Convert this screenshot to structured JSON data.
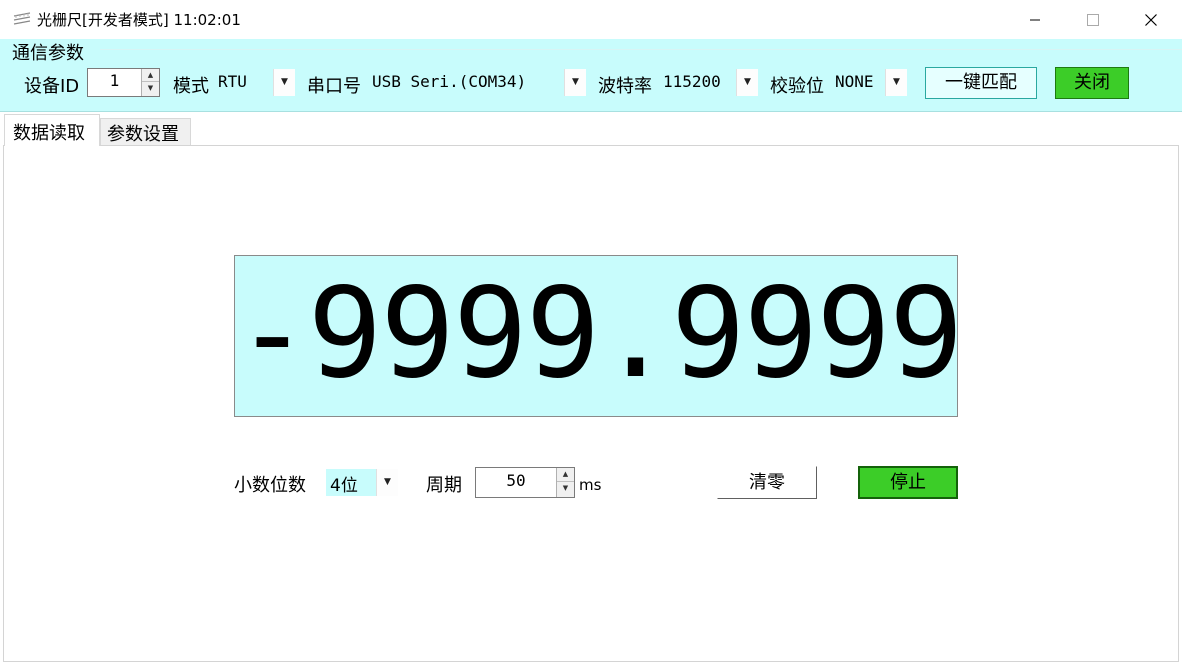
{
  "window": {
    "title": "光栅尺[开发者模式]",
    "time": "11:02:01",
    "icon": "ruler-app-icon",
    "controls": {
      "minimize": "minimize-icon",
      "maximize": "maximize-icon",
      "close": "close-icon"
    }
  },
  "comm": {
    "group_title": "通信参数",
    "device_id_label": "设备ID",
    "device_id_value": "1",
    "mode_label": "模式",
    "mode_value": "RTU",
    "port_label": "串口号",
    "port_value": "USB Seri.(COM34)",
    "baud_label": "波特率",
    "baud_value": "115200",
    "parity_label": "校验位",
    "parity_value": "NONE",
    "match_button": "一键匹配",
    "close_button": "关闭"
  },
  "tabs": [
    {
      "label": "数据读取",
      "active": true
    },
    {
      "label": "参数设置",
      "active": false
    }
  ],
  "reading": {
    "value": "-9999.9999"
  },
  "controls": {
    "decimals_label": "小数位数",
    "decimals_value": "4位",
    "period_label": "周期",
    "period_value": "50",
    "period_unit": "ms",
    "clear_button": "清零",
    "stop_button": "停止"
  },
  "colors": {
    "panel_bg": "#c8fcfc",
    "green_button": "#3ccd28"
  }
}
